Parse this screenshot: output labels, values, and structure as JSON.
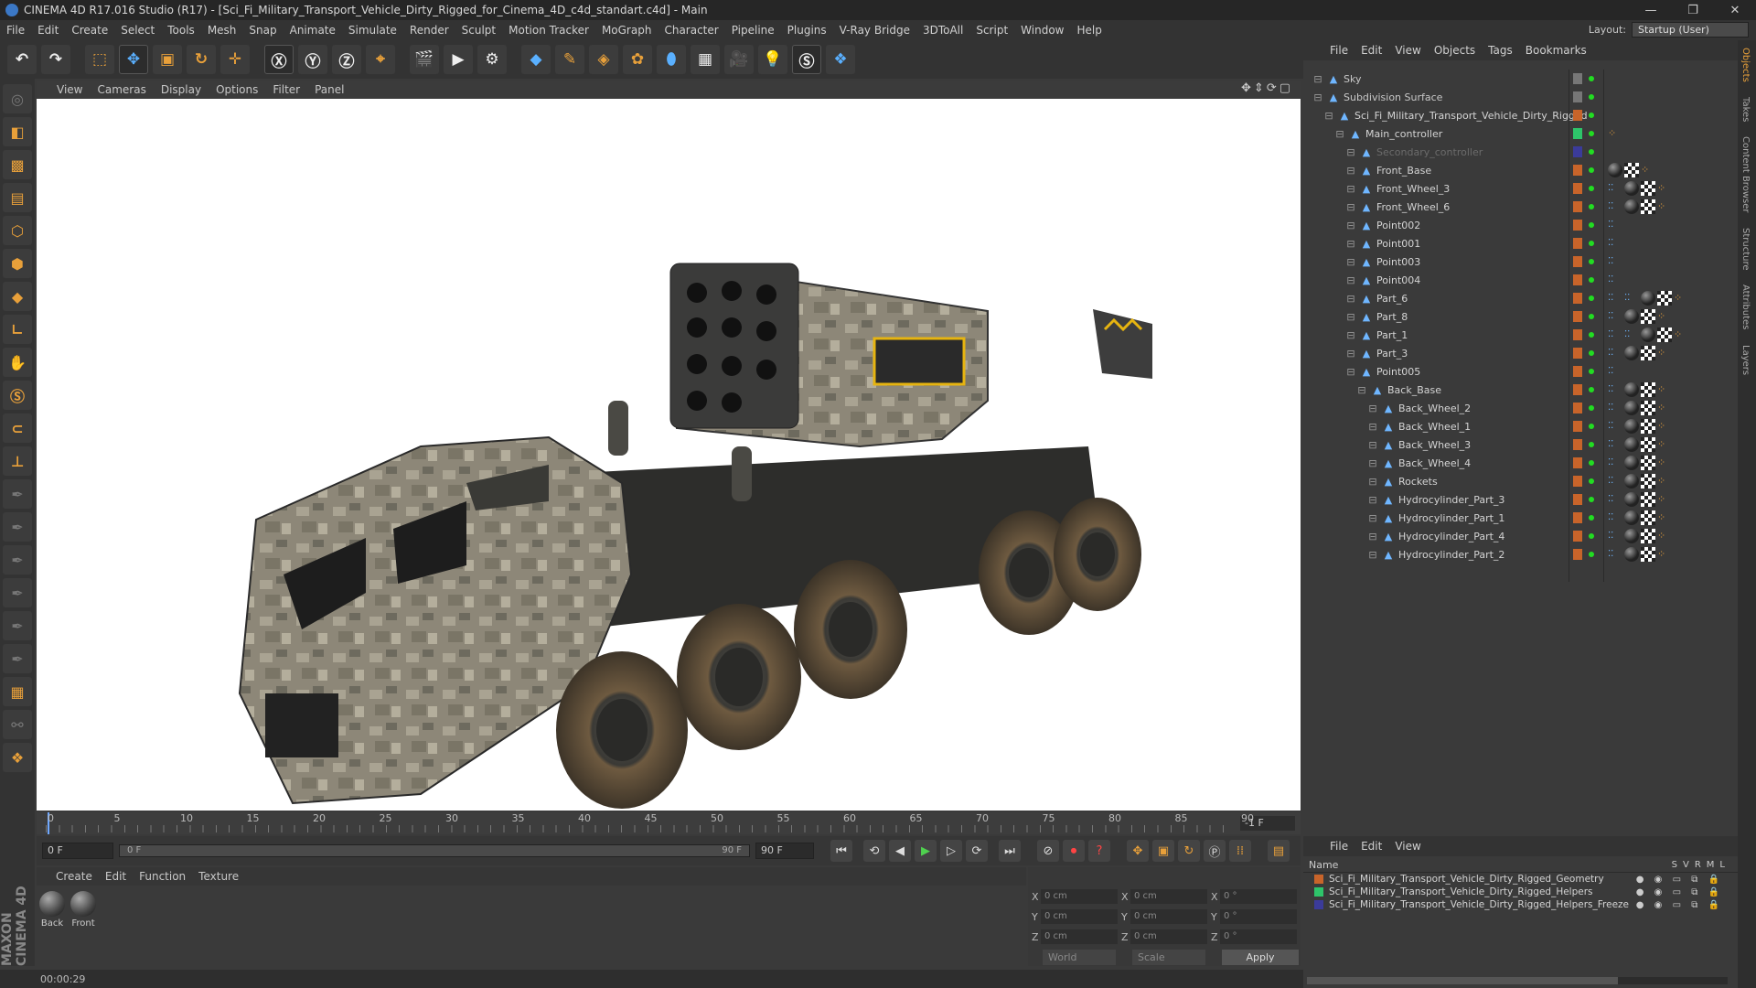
{
  "window": {
    "title": "CINEMA 4D R17.016 Studio (R17) - [Sci_Fi_Military_Transport_Vehicle_Dirty_Rigged_for_Cinema_4D_c4d_standart.c4d] - Main"
  },
  "menubar": {
    "items": [
      "File",
      "Edit",
      "Create",
      "Select",
      "Tools",
      "Mesh",
      "Snap",
      "Animate",
      "Simulate",
      "Render",
      "Sculpt",
      "Motion Tracker",
      "MoGraph",
      "Character",
      "Pipeline",
      "Plugins",
      "V-Ray Bridge",
      "3DToAll",
      "Script",
      "Window",
      "Help"
    ],
    "layout_label": "Layout:",
    "layout_value": "Startup (User)"
  },
  "viewport": {
    "menu": [
      "View",
      "Cameras",
      "Display",
      "Options",
      "Filter",
      "Panel"
    ]
  },
  "timeline": {
    "ticks": [
      "0",
      "5",
      "10",
      "15",
      "20",
      "25",
      "30",
      "35",
      "40",
      "45",
      "50",
      "55",
      "60",
      "65",
      "70",
      "75",
      "80",
      "85",
      "90"
    ],
    "frame_end": "-1 F"
  },
  "transport": {
    "start_frame": "0 F",
    "slider_start": "0 F",
    "slider_end": "90 F",
    "end_frame": "90 F"
  },
  "material_panel": {
    "menu": [
      "Create",
      "Edit",
      "Function",
      "Texture"
    ],
    "materials": [
      {
        "label": "Back"
      },
      {
        "label": "Front"
      }
    ]
  },
  "coord_panel": {
    "rows": [
      {
        "a": "X",
        "pos": "0 cm",
        "b": "X",
        "size": "0 cm",
        "c": "X",
        "rot": "0 °"
      },
      {
        "a": "Y",
        "pos": "0 cm",
        "b": "Y",
        "size": "0 cm",
        "c": "Y",
        "rot": "0 °"
      },
      {
        "a": "Z",
        "pos": "0 cm",
        "b": "Z",
        "size": "0 cm",
        "c": "Z",
        "rot": "0 °"
      }
    ],
    "space": "World",
    "mode": "Scale",
    "apply": "Apply"
  },
  "statusbar": {
    "time": "00:00:29"
  },
  "object_manager": {
    "menu": [
      "File",
      "Edit",
      "View",
      "Objects",
      "Tags",
      "Bookmarks"
    ],
    "objects": [
      {
        "name": "Sky",
        "indent": 0,
        "color": "#c8c8c8",
        "tags": []
      },
      {
        "name": "Subdivision Surface",
        "indent": 0,
        "color": "#c8c8c8",
        "tags": []
      },
      {
        "name": "Sci_Fi_Military_Transport_Vehicle_Dirty_Rigged",
        "indent": 1,
        "color": "#d4d4d4",
        "tags": []
      },
      {
        "name": "Main_controller",
        "indent": 2,
        "color": "#d4d4d4",
        "tags": [
          "ik"
        ]
      },
      {
        "name": "Secondary_controller",
        "indent": 3,
        "color": "#6b6b6b",
        "tags": []
      },
      {
        "name": "Front_Base",
        "indent": 3,
        "color": "#d4d4d4",
        "tags": [
          "mat",
          "chk",
          "ik"
        ]
      },
      {
        "name": "Front_Wheel_3",
        "indent": 3,
        "color": "#d4d4d4",
        "tags": [
          "dots",
          "mat",
          "chk",
          "ik"
        ]
      },
      {
        "name": "Front_Wheel_6",
        "indent": 3,
        "color": "#d4d4d4",
        "tags": [
          "dots",
          "mat",
          "chk",
          "ik"
        ]
      },
      {
        "name": "Point002",
        "indent": 3,
        "color": "#d4d4d4",
        "tags": [
          "dots"
        ]
      },
      {
        "name": "Point001",
        "indent": 3,
        "color": "#d4d4d4",
        "tags": [
          "dots"
        ]
      },
      {
        "name": "Point003",
        "indent": 3,
        "color": "#d4d4d4",
        "tags": [
          "dots"
        ]
      },
      {
        "name": "Point004",
        "indent": 3,
        "color": "#d4d4d4",
        "tags": [
          "dots"
        ]
      },
      {
        "name": "Part_6",
        "indent": 3,
        "color": "#d4d4d4",
        "tags": [
          "dots",
          "dots",
          "mat",
          "chk",
          "ik"
        ]
      },
      {
        "name": "Part_8",
        "indent": 3,
        "color": "#d4d4d4",
        "tags": [
          "dots",
          "mat",
          "chk",
          "ik"
        ]
      },
      {
        "name": "Part_1",
        "indent": 3,
        "color": "#d4d4d4",
        "tags": [
          "dots",
          "dots",
          "mat",
          "chk",
          "ik"
        ]
      },
      {
        "name": "Part_3",
        "indent": 3,
        "color": "#d4d4d4",
        "tags": [
          "dots",
          "mat",
          "chk",
          "ik"
        ]
      },
      {
        "name": "Point005",
        "indent": 3,
        "color": "#d4d4d4",
        "tags": [
          "dots"
        ]
      },
      {
        "name": "Back_Base",
        "indent": 4,
        "color": "#d4d4d4",
        "tags": [
          "dots",
          "mat",
          "chk",
          "ik"
        ]
      },
      {
        "name": "Back_Wheel_2",
        "indent": 5,
        "color": "#d4d4d4",
        "tags": [
          "dots",
          "mat",
          "chk",
          "ik"
        ]
      },
      {
        "name": "Back_Wheel_1",
        "indent": 5,
        "color": "#d4d4d4",
        "tags": [
          "dots",
          "mat",
          "chk",
          "ik"
        ]
      },
      {
        "name": "Back_Wheel_3",
        "indent": 5,
        "color": "#d4d4d4",
        "tags": [
          "dots",
          "mat",
          "chk",
          "ik"
        ]
      },
      {
        "name": "Back_Wheel_4",
        "indent": 5,
        "color": "#d4d4d4",
        "tags": [
          "dots",
          "mat",
          "chk",
          "ik"
        ]
      },
      {
        "name": "Rockets",
        "indent": 5,
        "color": "#d4d4d4",
        "tags": [
          "dots",
          "mat",
          "chk",
          "ik"
        ]
      },
      {
        "name": "Hydrocylinder_Part_3",
        "indent": 5,
        "color": "#d4d4d4",
        "tags": [
          "dots",
          "mat",
          "chk",
          "ik"
        ]
      },
      {
        "name": "Hydrocylinder_Part_1",
        "indent": 5,
        "color": "#d4d4d4",
        "tags": [
          "dots",
          "mat",
          "chk",
          "ik"
        ]
      },
      {
        "name": "Hydrocylinder_Part_4",
        "indent": 5,
        "color": "#d4d4d4",
        "tags": [
          "dots",
          "mat",
          "chk",
          "ik"
        ]
      },
      {
        "name": "Hydrocylinder_Part_2",
        "indent": 5,
        "color": "#d4d4d4",
        "tags": [
          "dots",
          "mat",
          "chk",
          "ik"
        ]
      }
    ]
  },
  "layer_manager": {
    "menu": [
      "File",
      "Edit",
      "View"
    ],
    "header_name": "Name",
    "columns": [
      "S",
      "V",
      "R",
      "M",
      "L"
    ],
    "layers": [
      {
        "name": "Sci_Fi_Military_Transport_Vehicle_Dirty_Rigged_Geometry",
        "color": "#c8642a"
      },
      {
        "name": "Sci_Fi_Military_Transport_Vehicle_Dirty_Rigged_Helpers",
        "color": "#2ec46a"
      },
      {
        "name": "Sci_Fi_Military_Transport_Vehicle_Dirty_Rigged_Helpers_Freeze",
        "color": "#3b3b9a"
      }
    ]
  },
  "side_tabs": [
    "Objects",
    "Takes",
    "Content Browser",
    "Structure",
    "Attributes",
    "Layers"
  ],
  "brand": "MAXON CINEMA 4D"
}
